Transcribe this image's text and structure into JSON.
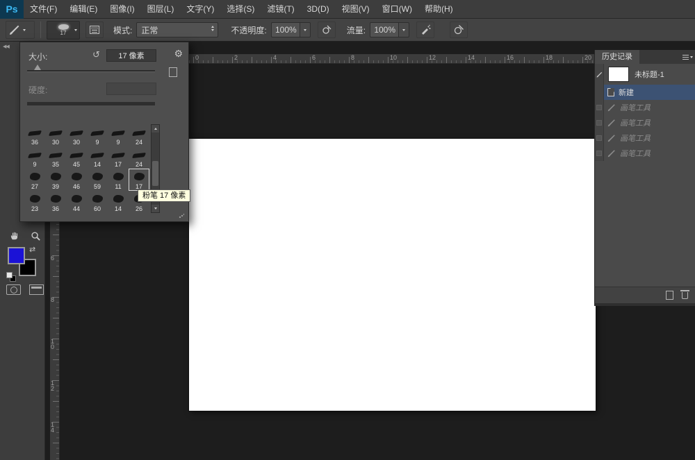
{
  "window": {
    "logo": "Ps"
  },
  "glyphs": {
    "gear": "⚙",
    "reset": "↺",
    "collapse": "◀◀",
    "swap": "⇄"
  },
  "menu": {
    "items": [
      "文件(F)",
      "编辑(E)",
      "图像(I)",
      "图层(L)",
      "文字(Y)",
      "选择(S)",
      "滤镜(T)",
      "3D(D)",
      "视图(V)",
      "窗口(W)",
      "帮助(H)"
    ]
  },
  "options": {
    "brush_size": "17",
    "mode_label": "模式:",
    "mode_value": "正常",
    "opacity_label": "不透明度:",
    "opacity_value": "100%",
    "flow_label": "流量:",
    "flow_value": "100%"
  },
  "brush_panel": {
    "size_label": "大小:",
    "size_value": "17 像素",
    "hardness_label": "硬度:",
    "tooltip": "粉笔 17 像素",
    "grid": [
      "36",
      "30",
      "30",
      "9",
      "9",
      "24",
      "9",
      "35",
      "45",
      "14",
      "17",
      "24",
      "27",
      "39",
      "46",
      "59",
      "11",
      "17",
      "23",
      "36",
      "44",
      "60",
      "14",
      "26"
    ]
  },
  "rulers": {
    "horizontal": [
      "0",
      "2",
      "4",
      "6",
      "8",
      "10",
      "12",
      "14",
      "16",
      "18",
      "20"
    ],
    "vertical": [
      "6",
      "8",
      "10",
      "12",
      "14"
    ]
  },
  "history": {
    "title": "历史记录",
    "snapshot": "未标题-1",
    "states": [
      {
        "label": "新建"
      },
      {
        "label": "画笔工具"
      },
      {
        "label": "画笔工具"
      },
      {
        "label": "画笔工具"
      },
      {
        "label": "画笔工具"
      }
    ]
  },
  "colors": {
    "foreground_swatch": "#1b12d6",
    "background_swatch": "#000000",
    "selected_state": "#3c5273",
    "canvas": "#ffffff",
    "ui_dark": "#1d1d1d"
  }
}
